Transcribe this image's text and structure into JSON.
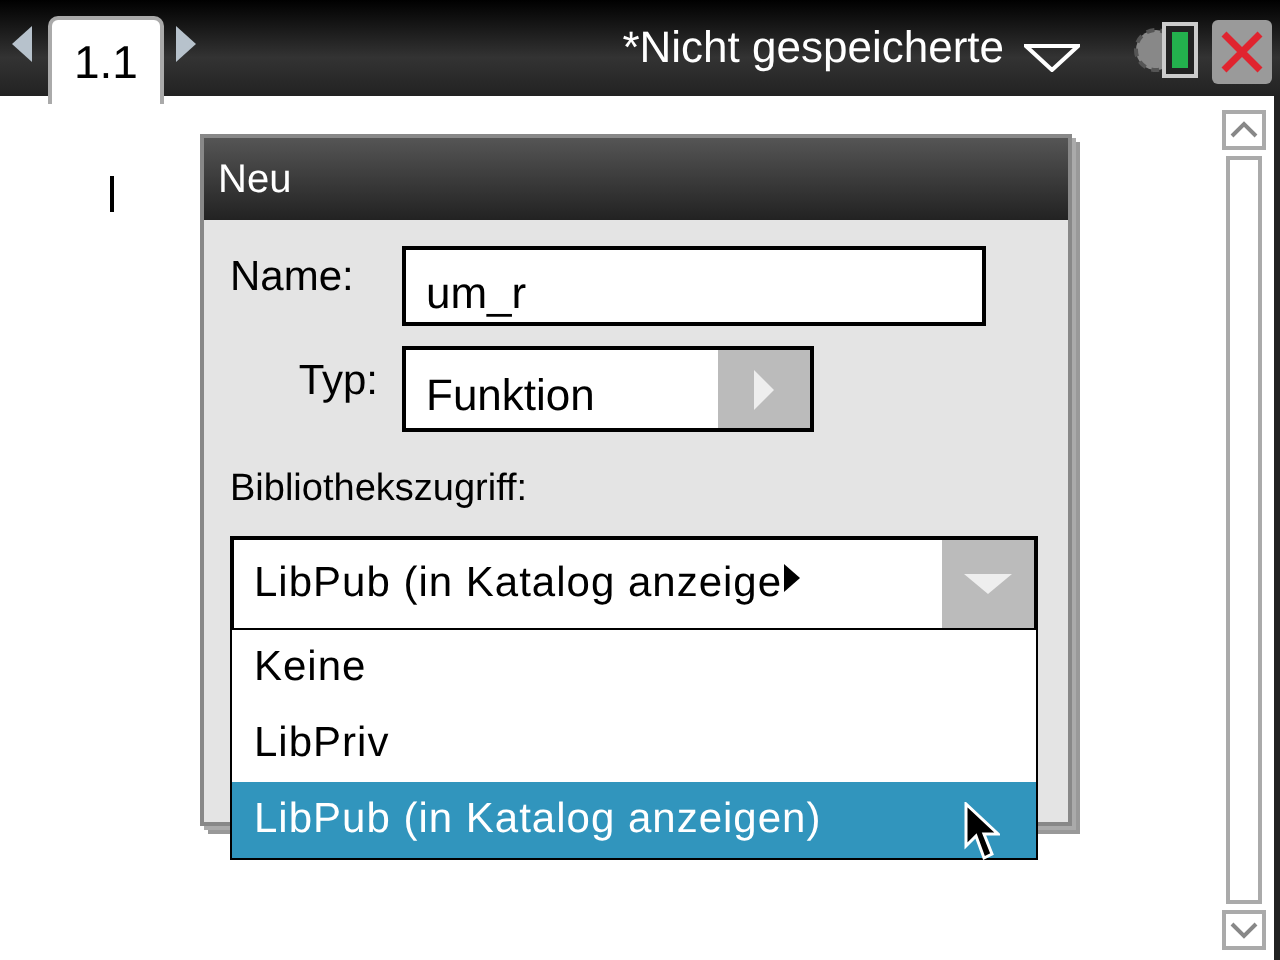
{
  "tab": {
    "label": "1.1",
    "selected": true
  },
  "document_title": "*Nicht gespeicherte",
  "dialog": {
    "title": "Neu",
    "fields": [
      {
        "kind": "text",
        "label": "Name:",
        "value": "um_r"
      },
      {
        "kind": "select",
        "label": "Typ:",
        "value": "Funktion"
      }
    ],
    "library_label": "Bibliothekszugriff:",
    "library_value": "LibPub (in Katalog anzeige",
    "options": [
      {
        "label": "Keine",
        "selected": false
      },
      {
        "label": "LibPriv",
        "selected": false
      },
      {
        "label": "LibPub (in Katalog anzeigen)",
        "selected": true
      }
    ]
  }
}
